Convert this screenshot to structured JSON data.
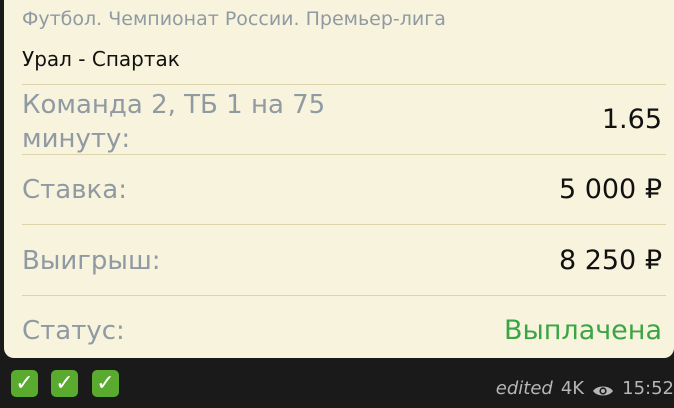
{
  "bet": {
    "league": "Футбол. Чемпионат России. Премьер-лига",
    "match": "Урал - Спартак",
    "rows": [
      {
        "label": "Команда 2, ТБ 1 на 75 минуту:",
        "value": "1.65"
      },
      {
        "label": "Ставка:",
        "value": "5 000 ₽"
      },
      {
        "label": "Выигрыш:",
        "value": "8 250 ₽"
      },
      {
        "label": "Статус:",
        "value": "Выплачена"
      }
    ]
  },
  "footer": {
    "reactions": [
      "✓",
      "✓",
      "✓"
    ],
    "edited": "edited",
    "views": "4K",
    "time": "15:52"
  },
  "colors": {
    "card_bg": "#f8f3dc",
    "status_paid": "#3aa544",
    "check_bg": "#5aaa2f"
  },
  "icons": {
    "check": "check-mark-icon",
    "views": "eye-icon"
  }
}
